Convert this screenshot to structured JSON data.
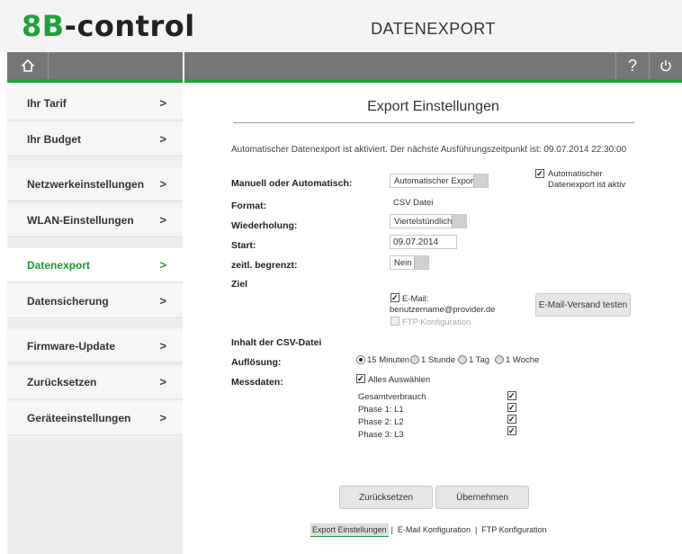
{
  "app": {
    "logo_prefix": "8B",
    "logo_suffix": "-control",
    "section_title": "DATENEXPORT"
  },
  "colors": {
    "accent": "#1ea33a",
    "bar": "#767676",
    "active_text": "#1e9a35"
  },
  "topbar": {
    "home_icon": "home-icon",
    "help_label": "?",
    "power_icon": "power-icon"
  },
  "sidebar": {
    "items": [
      {
        "label": "Ihr Tarif",
        "active": false
      },
      {
        "label": "Ihr Budget",
        "active": false
      },
      {
        "label": "Netzwerkeinstellungen",
        "active": false
      },
      {
        "label": "WLAN-Einstellungen",
        "active": false
      },
      {
        "label": "Datenexport",
        "active": true
      },
      {
        "label": "Datensicherung",
        "active": false
      },
      {
        "label": "Firmware-Update",
        "active": false
      },
      {
        "label": "Zurücksetzen",
        "active": false
      },
      {
        "label": "Geräteeinstellungen",
        "active": false
      }
    ],
    "chevron": ">"
  },
  "main": {
    "title": "Export Einstellungen",
    "info": "Automatischer Datenexport ist aktiviert. Der nächste Ausführungszeitpunkt ist: 09.07.2014 22:30:00",
    "mode": {
      "label": "Manuell oder Automatisch:",
      "value": "Automatischer Export",
      "auto_checked": true,
      "auto_note": "Automatischer Datenexport ist aktiv"
    },
    "format": {
      "label": "Format:",
      "value": "CSV Datei"
    },
    "repeat": {
      "label": "Wiederholung:",
      "value": "Viertelstündlich"
    },
    "start": {
      "label": "Start:",
      "value": "09.07.2014"
    },
    "limited": {
      "label": "zeitl. begrenzt:",
      "value": "Nein"
    },
    "target": {
      "label": "Ziel",
      "email_checked": true,
      "email_label": "E-Mail:",
      "email_address": "benutzername@provider.de",
      "ftp_checked": false,
      "ftp_label": "FTP Konfiguration",
      "test_button": "E-Mail-Versand testen"
    },
    "csv_heading": "Inhalt der CSV-Datei",
    "resolution": {
      "label": "Auflösung:",
      "options": [
        "15 Minuten",
        "1 Stunde",
        "1 Tag",
        "1 Woche"
      ],
      "selected": "15 Minuten"
    },
    "measures": {
      "label": "Messdaten:",
      "select_all_label": "Alles Auswählen",
      "select_all_checked": true,
      "items": [
        {
          "label": "Gesamtverbrauch",
          "checked": true
        },
        {
          "label": "Phase 1: L1",
          "checked": true
        },
        {
          "label": "Phase 2: L2",
          "checked": true
        },
        {
          "label": "Phase 3: L3",
          "checked": true
        }
      ]
    },
    "reset_button": "Zurücksetzen",
    "apply_button": "Übernehmen",
    "subnav": [
      {
        "label": "Export Einstellungen",
        "active": true
      },
      {
        "label": "E-Mail Konfiguration",
        "active": false
      },
      {
        "label": "FTP Konfiguration",
        "active": false
      }
    ],
    "subnav_separator": "|"
  }
}
